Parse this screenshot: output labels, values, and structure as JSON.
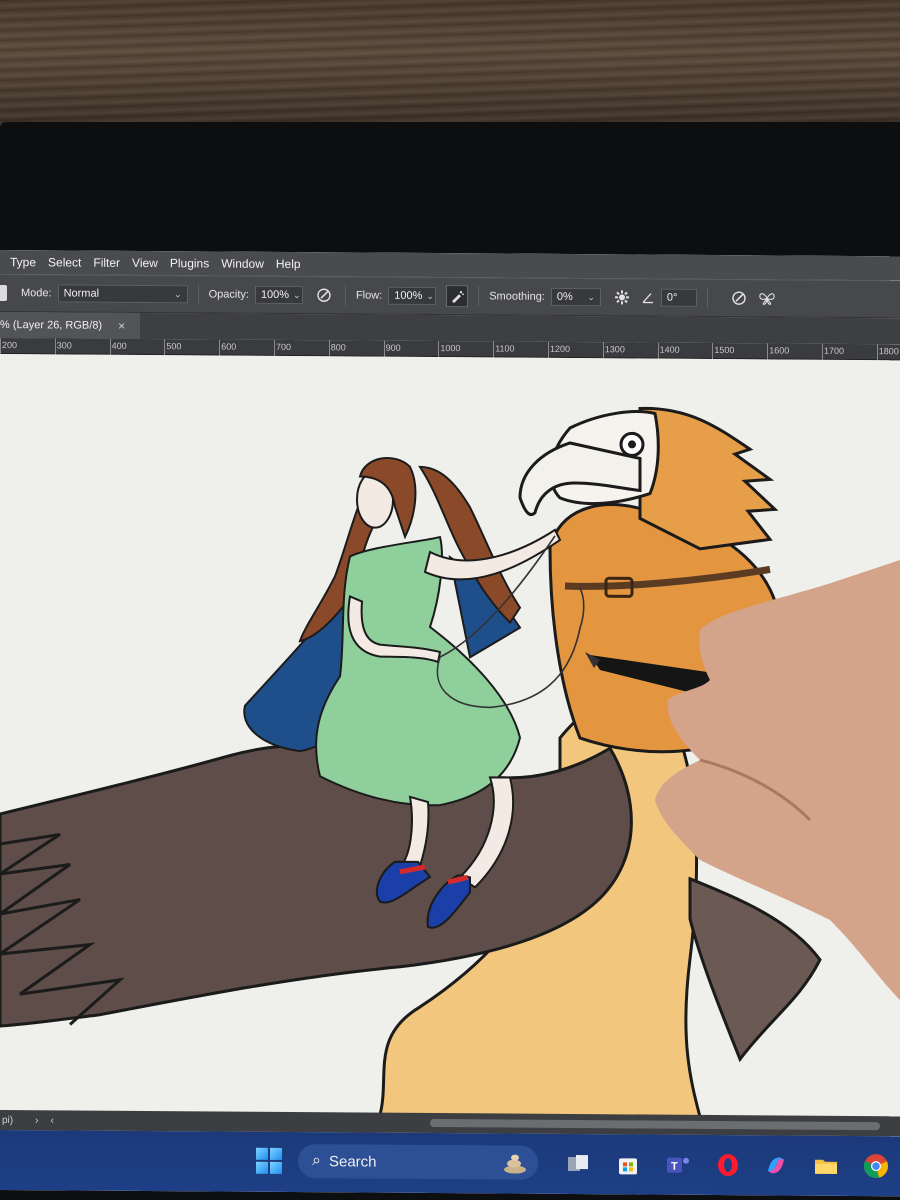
{
  "menu": {
    "items": [
      "Type",
      "Select",
      "Filter",
      "View",
      "Plugins",
      "Window",
      "Help"
    ]
  },
  "options": {
    "mode_label": "Mode:",
    "mode_value": "Normal",
    "opacity_label": "Opacity:",
    "opacity_value": "100%",
    "flow_label": "Flow:",
    "flow_value": "100%",
    "smoothing_label": "Smoothing:",
    "smoothing_value": "0%",
    "angle_value": "0°"
  },
  "document": {
    "tab_title": "% (Layer 26, RGB/8)",
    "close_symbol": "×"
  },
  "ruler": {
    "labels": [
      "200",
      "300",
      "400",
      "500",
      "600",
      "700",
      "800",
      "900",
      "1000",
      "1100",
      "1200",
      "1300",
      "1400",
      "1500",
      "1600",
      "1700",
      "1800"
    ]
  },
  "status": {
    "zoom_text": "pi)",
    "arrow_right": "›",
    "arrow_left": "‹"
  },
  "taskbar": {
    "search_placeholder": "Search",
    "pinned": [
      "task-view-icon",
      "store-icon",
      "teams-icon",
      "opera-icon",
      "copilot-icon",
      "file-explorer-icon",
      "chrome-icon"
    ]
  },
  "colors": {
    "menubar": "#4a4b4e",
    "optionsbar": "#47484b",
    "canvas": "#efefec",
    "taskbar": "#1e3f86",
    "dress": "#8fcf9c",
    "cape": "#1f4f8a",
    "eagle_head": "#e3953f",
    "wing": "#5e4d49",
    "body_feathers": "#f2c77d"
  }
}
